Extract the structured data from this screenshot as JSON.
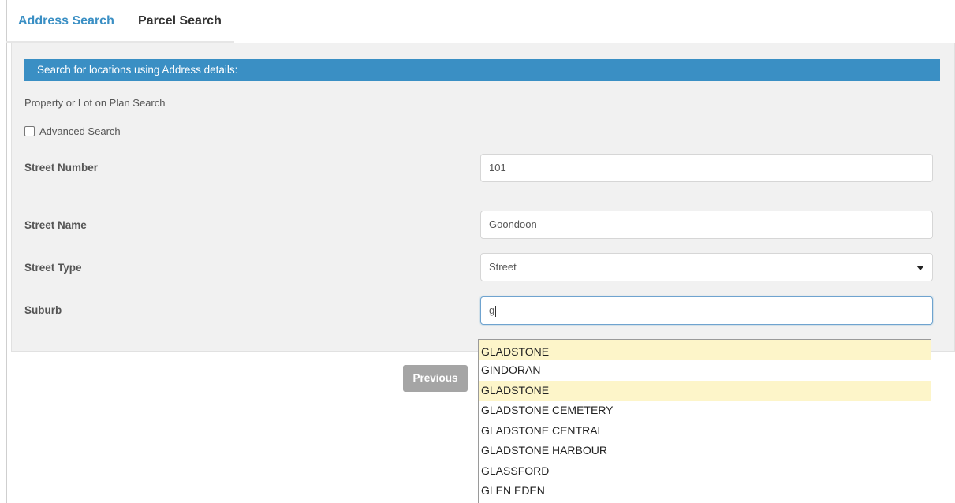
{
  "tabs": [
    {
      "label": "Address Search",
      "active": true
    },
    {
      "label": "Parcel Search",
      "active": false
    }
  ],
  "panel": {
    "header": "Search for locations using Address details:",
    "subtitle": "Property or Lot on Plan Search",
    "advanced_label": "Advanced Search",
    "advanced_checked": false
  },
  "form": {
    "street_number": {
      "label": "Street Number",
      "value": "101"
    },
    "street_name": {
      "label": "Street Name",
      "value": "Goondoon"
    },
    "street_type": {
      "label": "Street Type",
      "value": "Street"
    },
    "suburb": {
      "label": "Suburb",
      "value": "g"
    }
  },
  "buttons": {
    "previous": "Previous"
  },
  "suggestions": [
    "GLADSTONE",
    "GINDORAN",
    "GLADSTONE",
    "GLADSTONE CEMETERY",
    "GLADSTONE CENTRAL",
    "GLADSTONE HARBOUR",
    "GLASSFORD",
    "GLEN EDEN"
  ],
  "colors": {
    "accent": "#3a8fc4",
    "highlight": "#fdf5c9",
    "button_disabled": "#a5a5a5"
  },
  "icons": {
    "select_caret": "caret-down-icon",
    "checkbox": "checkbox-icon"
  }
}
